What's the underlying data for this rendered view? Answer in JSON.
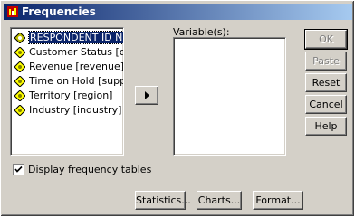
{
  "window": {
    "title": "Frequencies"
  },
  "source_list": {
    "items": [
      {
        "label": "RESPONDENT ID NU",
        "selected": true
      },
      {
        "label": "Customer Status [custo",
        "selected": false
      },
      {
        "label": "Revenue [revenue]",
        "selected": false
      },
      {
        "label": "Time on Hold [support]",
        "selected": false
      },
      {
        "label": "Territory [region]",
        "selected": false
      },
      {
        "label": "Industry [industry]",
        "selected": false
      }
    ]
  },
  "move_button": {
    "icon": "right-arrow-icon"
  },
  "variables": {
    "label": "Variable(s):",
    "items": []
  },
  "buttons": {
    "ok": "OK",
    "paste": "Paste",
    "reset": "Reset",
    "cancel": "Cancel",
    "help": "Help"
  },
  "display_tables": {
    "label": "Display frequency tables",
    "checked": true
  },
  "bottom_buttons": {
    "statistics": "Statistics...",
    "charts": "Charts...",
    "format": "Format..."
  },
  "colors": {
    "title_start": "#0a246a",
    "title_end": "#a6caf0",
    "face": "#d4d0c8"
  }
}
